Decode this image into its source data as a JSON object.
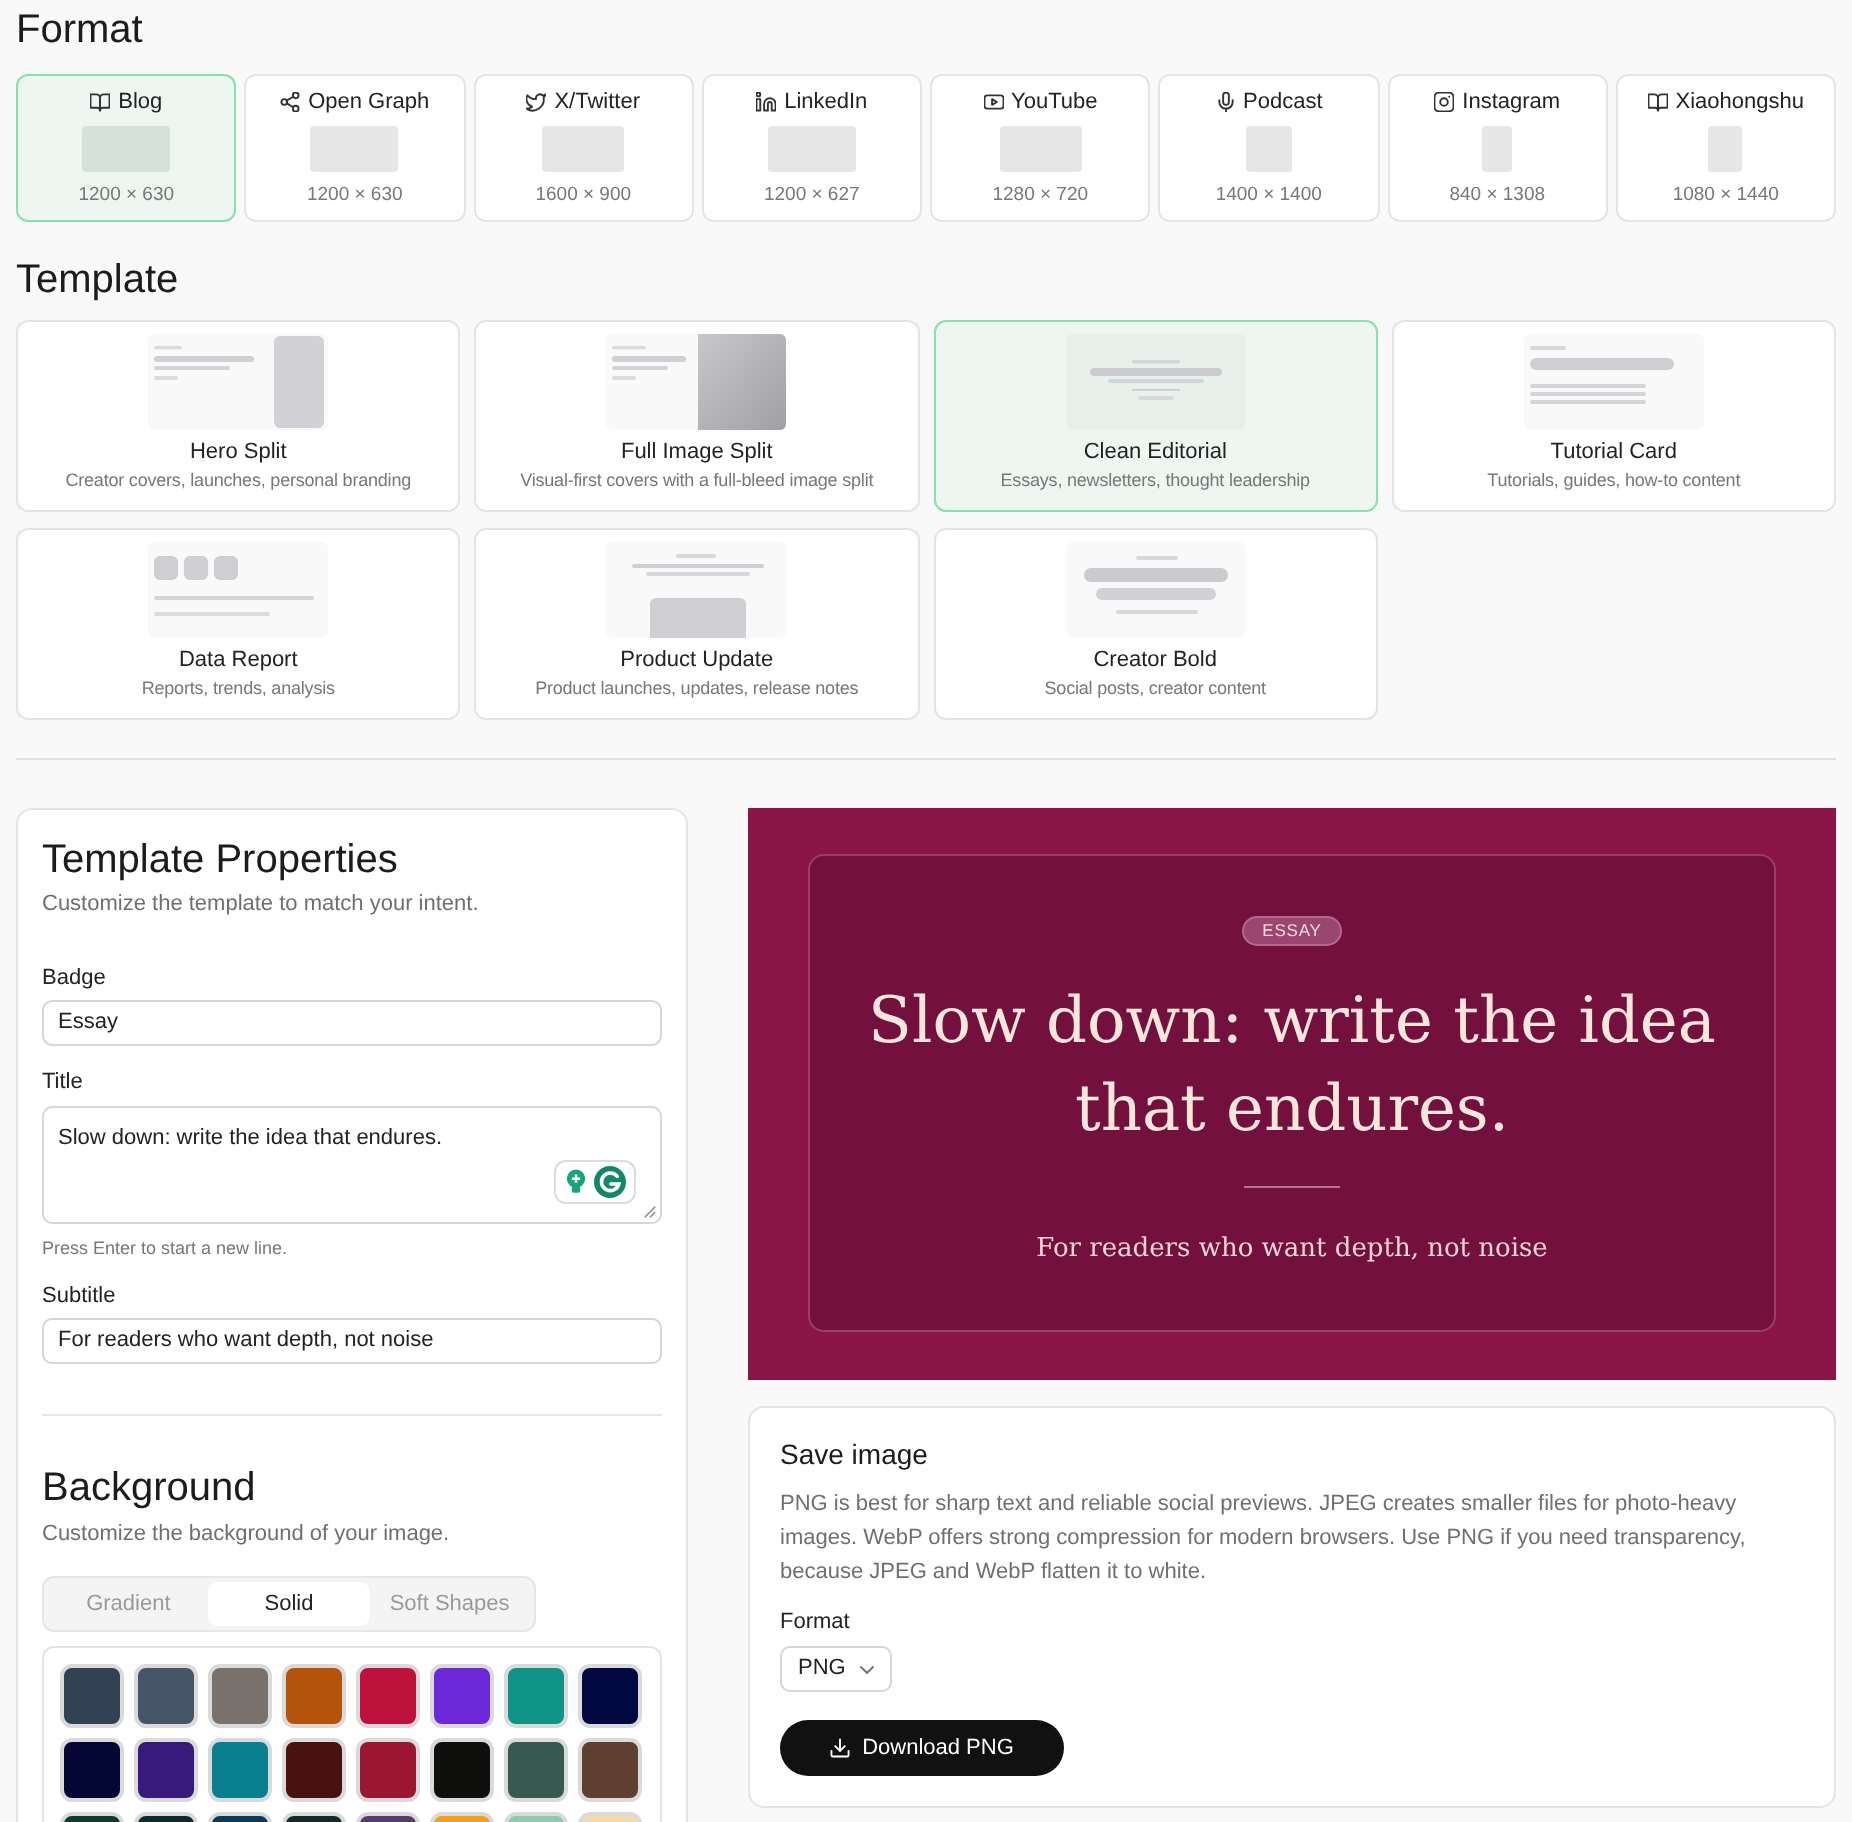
{
  "format_section": {
    "heading": "Format",
    "formats": [
      {
        "label": "Blog",
        "size": "1200 × 630",
        "selected": true
      },
      {
        "label": "Open Graph",
        "size": "1200 × 630",
        "selected": false
      },
      {
        "label": "X/Twitter",
        "size": "1600 × 900",
        "selected": false
      },
      {
        "label": "LinkedIn",
        "size": "1200 × 627",
        "selected": false
      },
      {
        "label": "YouTube",
        "size": "1280 × 720",
        "selected": false
      },
      {
        "label": "Podcast",
        "size": "1400 × 1400",
        "selected": false
      },
      {
        "label": "Instagram",
        "size": "840 × 1308",
        "selected": false
      },
      {
        "label": "Xiaohongshu",
        "size": "1080 × 1440",
        "selected": false
      }
    ]
  },
  "template_section": {
    "heading": "Template",
    "templates": [
      {
        "name": "Hero Split",
        "description": "Creator covers, launches, personal branding",
        "selected": false
      },
      {
        "name": "Full Image Split",
        "description": "Visual-first covers with a full-bleed image split",
        "selected": false
      },
      {
        "name": "Clean Editorial",
        "description": "Essays, newsletters, thought leadership",
        "selected": true
      },
      {
        "name": "Tutorial Card",
        "description": "Tutorials, guides, how-to content",
        "selected": false
      },
      {
        "name": "Data Report",
        "description": "Reports, trends, analysis",
        "selected": false
      },
      {
        "name": "Product Update",
        "description": "Product launches, updates, release notes",
        "selected": false
      },
      {
        "name": "Creator Bold",
        "description": "Social posts, creator content",
        "selected": false
      }
    ]
  },
  "properties_panel": {
    "title": "Template Properties",
    "description": "Customize the template to match your intent.",
    "fields": [
      {
        "kind": "input",
        "label": "Badge",
        "value": "Essay"
      },
      {
        "kind": "textarea",
        "label": "Title",
        "value": "Slow down: write the idea that endures.",
        "hint": "Press Enter to start a new line."
      },
      {
        "kind": "input",
        "label": "Subtitle",
        "value": "For readers who want depth, not noise"
      }
    ]
  },
  "background_panel": {
    "title": "Background",
    "description": "Customize the background of your image.",
    "tabs": [
      {
        "label": "Gradient",
        "selected": false
      },
      {
        "label": "Solid",
        "selected": true
      },
      {
        "label": "Soft Shapes",
        "selected": false
      }
    ],
    "swatches": [
      {
        "color": "#334155"
      },
      {
        "color": "#475569"
      },
      {
        "color": "#78716c"
      },
      {
        "color": "#b45309"
      },
      {
        "color": "#be123c"
      },
      {
        "color": "#6d28d9"
      },
      {
        "color": "#0f9488"
      },
      {
        "color": "#020842"
      },
      {
        "color": "#020734"
      },
      {
        "color": "#371a79"
      },
      {
        "color": "#08808f"
      },
      {
        "color": "#4a1111"
      },
      {
        "color": "#9b1632"
      },
      {
        "color": "#0f0f0d"
      },
      {
        "color": "#37594f"
      },
      {
        "color": "#5f4030"
      },
      {
        "color": "#0d3b2e"
      },
      {
        "color": "#0b2b2c"
      },
      {
        "color": "#0b3b5a"
      },
      {
        "color": "#0f2b2b"
      },
      {
        "color": "#5b3a6e"
      },
      {
        "color": "#f59e1b"
      },
      {
        "color": "#8ccbb0"
      },
      {
        "color": "#f4dba8"
      }
    ]
  },
  "preview": {
    "badge": "ESSAY",
    "title": "Slow down: write the idea that endures.",
    "subtitle": "For readers who want depth, not noise"
  },
  "save_panel": {
    "title": "Save image",
    "description": "PNG is best for sharp text and reliable social previews. JPEG creates smaller files for photo-heavy images. WebP offers strong compression for modern browsers. Use PNG if you need transparency, because JPEG and WebP flatten it to white.",
    "format_label": "Format",
    "format_value": "PNG",
    "download_label": "Download PNG"
  }
}
